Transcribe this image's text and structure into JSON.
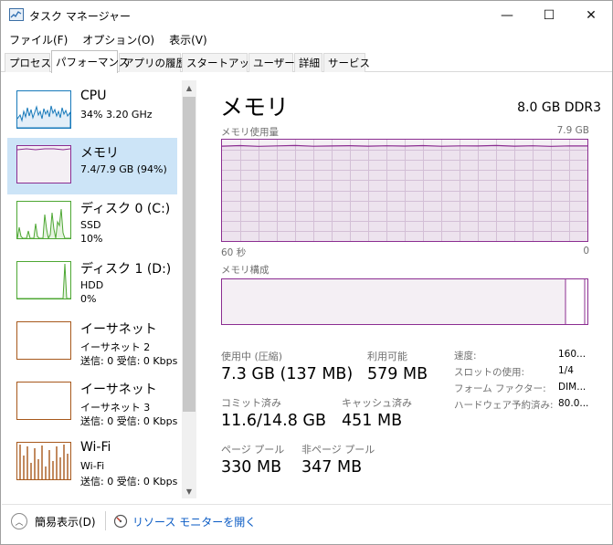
{
  "window": {
    "title": "タスク マネージャー",
    "controls": {
      "minimize": "—",
      "maximize": "☐",
      "close": "✕"
    }
  },
  "menu": [
    {
      "label": "ファイル(F)"
    },
    {
      "label": "オプション(O)"
    },
    {
      "label": "表示(V)"
    }
  ],
  "tabs": [
    {
      "label": "プロセス",
      "active": false
    },
    {
      "label": "パフォーマンス",
      "active": true
    },
    {
      "label": "アプリの履歴",
      "active": false
    },
    {
      "label": "スタートアップ",
      "active": false
    },
    {
      "label": "ユーザー",
      "active": false
    },
    {
      "label": "詳細",
      "active": false
    },
    {
      "label": "サービス",
      "active": false
    }
  ],
  "resources": [
    {
      "name": "CPU",
      "sub1": "34%  3.20 GHz",
      "sub2": "",
      "color": "#1779ba",
      "selected": false
    },
    {
      "name": "メモリ",
      "sub1": "7.4/7.9 GB (94%)",
      "sub2": "",
      "color": "#8b2d91",
      "selected": true
    },
    {
      "name": "ディスク 0 (C:)",
      "sub1": "SSD",
      "sub2": "10%",
      "color": "#4da733",
      "selected": false
    },
    {
      "name": "ディスク 1 (D:)",
      "sub1": "HDD",
      "sub2": "0%",
      "color": "#4da733",
      "selected": false
    },
    {
      "name": "イーサネット",
      "sub1": "イーサネット 2",
      "sub2": "送信: 0 受信: 0 Kbps",
      "color": "#a7581b",
      "selected": false
    },
    {
      "name": "イーサネット",
      "sub1": "イーサネット 3",
      "sub2": "送信: 0 受信: 0 Kbps",
      "color": "#a7581b",
      "selected": false
    },
    {
      "name": "Wi-Fi",
      "sub1": "Wi-Fi",
      "sub2": "送信: 0 受信: 0 Kbps",
      "color": "#a7581b",
      "selected": false
    }
  ],
  "detail": {
    "title": "メモリ",
    "subtitle": "8.0 GB DDR3",
    "usage_label": "メモリ使用量",
    "usage_max": "7.9 GB",
    "time_left": "60 秒",
    "time_right": "0",
    "composition_label": "メモリ構成",
    "memory_usage_percent": 94,
    "stats": {
      "in_use_label": "使用中 (圧縮)",
      "in_use_value": "7.3 GB (137 MB)",
      "available_label": "利用可能",
      "available_value": "579 MB",
      "committed_label": "コミット済み",
      "committed_value": "11.6/14.8 GB",
      "cached_label": "キャッシュ済み",
      "cached_value": "451 MB",
      "paged_label": "ページ プール",
      "paged_value": "330 MB",
      "nonpaged_label": "非ページ プール",
      "nonpaged_value": "347 MB"
    },
    "side": [
      {
        "label": "速度:",
        "value": "160..."
      },
      {
        "label": "スロットの使用:",
        "value": "1/4"
      },
      {
        "label": "フォーム ファクター:",
        "value": "DIM..."
      },
      {
        "label": "ハードウェア予約済み:",
        "value": "80.0..."
      }
    ]
  },
  "footer": {
    "fewer_details": "簡易表示(D)",
    "resource_monitor": "リソース モニターを開く"
  },
  "colors": {
    "memory": "#8b2d91",
    "cpu": "#1779ba",
    "disk": "#4da733",
    "ethernet": "#a7581b",
    "selection": "#cce4f7",
    "link": "#0a5bc4"
  }
}
